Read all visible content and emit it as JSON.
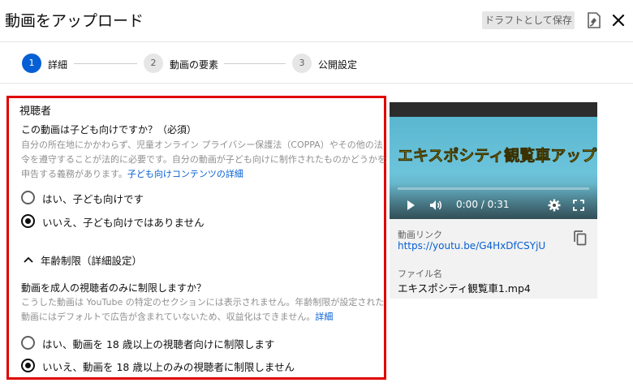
{
  "header": {
    "title": "動画をアップロード",
    "draft_button": "ドラフトとして保存"
  },
  "stepper": {
    "steps": [
      {
        "number": "1",
        "label": "詳細",
        "active": true
      },
      {
        "number": "2",
        "label": "動画の要素",
        "active": false
      },
      {
        "number": "3",
        "label": "公開設定",
        "active": false
      }
    ]
  },
  "audience": {
    "section_title": "視聴者",
    "question": "この動画は子ども向けですか？（必須）",
    "description_lines": [
      "自分の所在地にかかわらず、児童オンライン プライバシー保護法（COPPA）やその他の法",
      "令を遵守することが法的に必要です。自分の動画が子ども向けに制作されたものかどうかを",
      "申告する義務があります。"
    ],
    "description_link": "子ども向けコンテンツの詳細",
    "options": [
      {
        "label": "はい、子ども向けです",
        "checked": false
      },
      {
        "label": "いいえ、子ども向けではありません",
        "checked": true
      }
    ]
  },
  "age_restriction": {
    "toggle_label": "年齢制限（詳細設定）",
    "question": "動画を成人の視聴者のみに制限しますか？",
    "description_lines": [
      "こうした動画は YouTube の特定のセクションには表示されません。年齢制限が設定された",
      "動画にはデフォルトで広告が含まれていないため、収益化はできません。"
    ],
    "description_link": "詳細",
    "options": [
      {
        "label": "はい、動画を 18 歳以上の視聴者向けに制限します",
        "checked": false
      },
      {
        "label": "いいえ、動画を 18 歳以上のみの視聴者に制限しません",
        "checked": true
      }
    ]
  },
  "preview": {
    "video_caption": "エキスポシティ観覧車アップロード！",
    "time": "0:00 / 0:31",
    "link_label": "動画リンク",
    "link_url": "https://youtu.be/G4HxDfCSYjU",
    "filename_label": "ファイル名",
    "filename": "エキスポシティ観覧車1.mp4"
  },
  "colors": {
    "accent": "#065fd4",
    "highlight_box": "#e00000",
    "caption_yellow": "#fff000"
  },
  "icons": [
    "feedback-icon",
    "close-icon",
    "chevron-up-icon",
    "play-icon",
    "volume-icon",
    "settings-icon",
    "fullscreen-icon",
    "copy-icon"
  ]
}
